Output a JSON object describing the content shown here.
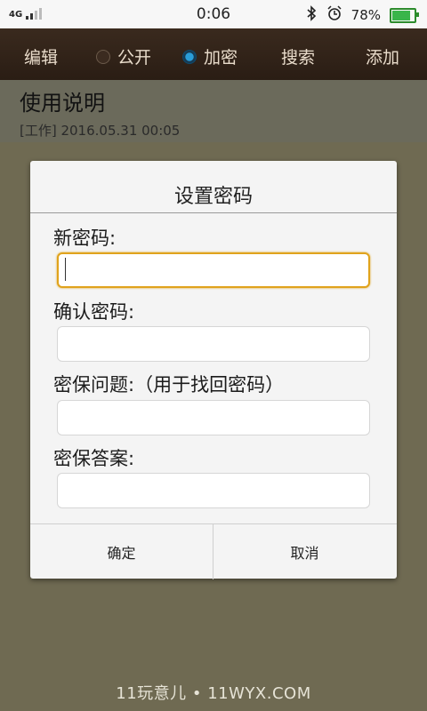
{
  "status_bar": {
    "network": "4G",
    "time": "0:06",
    "battery": "78%",
    "battery_level": 0.78,
    "icons": [
      "signal-icon",
      "bluetooth-icon",
      "alarm-icon",
      "battery-icon"
    ]
  },
  "toolbar": {
    "edit": "编辑",
    "public": "公开",
    "encrypt": "加密",
    "search": "搜索",
    "add": "添加",
    "selected_option": "加密"
  },
  "note": {
    "title": "使用说明",
    "meta": "[工作] 2016.05.31 00:05"
  },
  "dialog": {
    "title": "设置密码",
    "fields": [
      {
        "label": "新密码:",
        "value": ""
      },
      {
        "label": "确认密码:",
        "value": ""
      },
      {
        "label": "密保问题:（用于找回密码）",
        "value": ""
      },
      {
        "label": "密保答案:",
        "value": ""
      }
    ],
    "confirm": "确定",
    "cancel": "取消"
  },
  "watermark": "11玩意儿 • 11WYX.COM",
  "colors": {
    "toolbar_bg": "#2f2218",
    "focus_border": "#e0a31c",
    "radio_selected": "#2a9dd8"
  }
}
